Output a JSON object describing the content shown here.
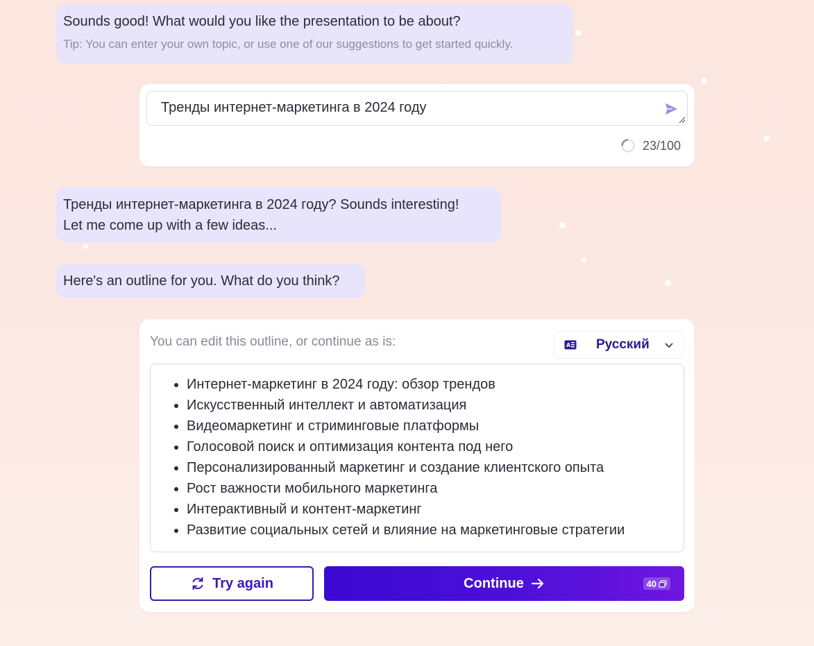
{
  "assistant_messages": {
    "prompt": "Sounds good! What would you like the presentation to be about?",
    "tip": "Tip: You can enter your own topic, or use one of our suggestions to get started quickly.",
    "reaction_line1": "Тренды интернет-маркетинга в 2024 году? Sounds interesting!",
    "reaction_line2": "Let me come up with a few ideas...",
    "outline_intro": "Here's an outline for you. What do you think?"
  },
  "topic_input": {
    "value": "Тренды интернет-маркетинга в 2024 году",
    "send_icon": "send-icon",
    "char_counter": "23/100"
  },
  "outline_card": {
    "instruction": "You can edit this outline, or continue as is:",
    "language": {
      "icon": "translate-icon",
      "selected": "Русский"
    },
    "items": [
      "Интернет-маркетинг в 2024 году: обзор трендов",
      "Искусственный интеллект и автоматизация",
      "Видеомаркетинг и стриминговые платформы",
      "Голосовой поиск и оптимизация контента под него",
      "Персонализированный маркетинг и создание клиентского опыта",
      "Рост важности мобильного маркетинга",
      "Интерактивный и контент-маркетинг",
      "Развитие социальных сетей и влияние на маркетинговые стратегии"
    ],
    "try_again_label": "Try again",
    "continue_label": "Continue",
    "credit_cost": "40"
  },
  "colors": {
    "bubble": "#e8e4fb",
    "accent": "#3a17b8",
    "continue_gradient_start": "#3a0ad2",
    "continue_gradient_end": "#6f16e0"
  }
}
